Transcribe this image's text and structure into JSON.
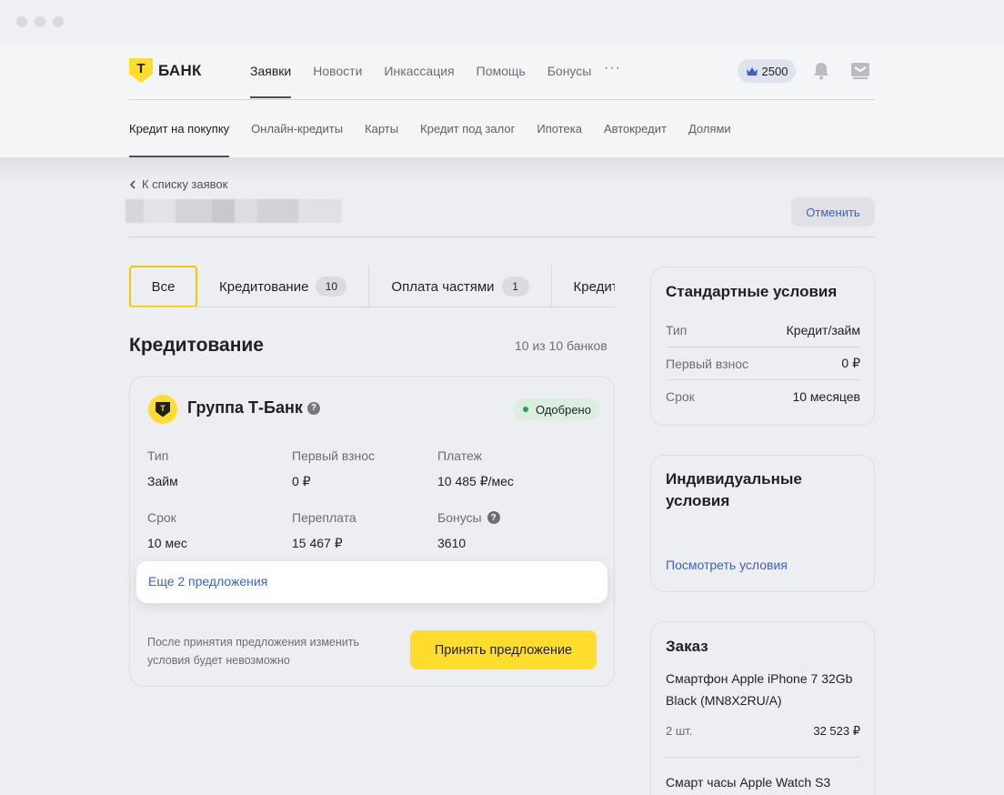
{
  "app": {
    "brand": "БАНК",
    "logo_letter": "Т"
  },
  "topnav": {
    "items": [
      "Заявки",
      "Новости",
      "Инкассация",
      "Помощь",
      "Бонусы"
    ],
    "more": "···",
    "bonus_points": "2500"
  },
  "subnav": {
    "items": [
      "Кредит на покупку",
      "Онлайн-кредиты",
      "Карты",
      "Кредит под залог",
      "Ипотека",
      "Автокредит",
      "Долями"
    ]
  },
  "page": {
    "back_link": "К списку заявок",
    "cancel_button": "Отменить"
  },
  "tabs": [
    {
      "label": "Все",
      "count": ""
    },
    {
      "label": "Кредитование",
      "count": "10"
    },
    {
      "label": "Оплата частями",
      "count": "1"
    },
    {
      "label": "Кредитные карты",
      "count": ""
    }
  ],
  "section": {
    "title": "Кредитование",
    "count": "10 из 10 банков"
  },
  "offer": {
    "bank_name": "Группа Т-Банк",
    "logo_letter": "Т",
    "status": "Одобрено",
    "fields": [
      {
        "label": "Тип",
        "value": "Займ"
      },
      {
        "label": "Первый взнос",
        "value": "0 ₽"
      },
      {
        "label": "Платеж",
        "value": "10 485 ₽/мес"
      },
      {
        "label": "Срок",
        "value": "10 мес"
      },
      {
        "label": "Переплата",
        "value": "15 467 ₽"
      },
      {
        "label": "Бонусы",
        "value": "3610"
      }
    ],
    "more_offers": "Еще 2 предложения",
    "disclaimer": "После принятия предложения изменить условия будет невозможно",
    "accept_button": "Принять предложение"
  },
  "standard_conditions": {
    "title": "Стандартные условия",
    "rows": [
      {
        "label": "Тип",
        "value": "Кредит/займ"
      },
      {
        "label": "Первый взнос",
        "value": "0 ₽"
      },
      {
        "label": "Срок",
        "value": "10 месяцев"
      }
    ]
  },
  "individual_conditions": {
    "title": "Индивидуальные условия",
    "link": "Посмотреть условия"
  },
  "order": {
    "title": "Заказ",
    "items": [
      {
        "name": "Смартфон Apple iPhone 7 32Gb Black (MN8X2RU/A)",
        "qty": "2 шт.",
        "price": "32 523 ₽"
      },
      {
        "name": "Смарт часы Apple Watch S3",
        "qty": "",
        "price": ""
      }
    ]
  },
  "colors": {
    "brand_yellow": "#ffdd2d",
    "link_blue": "#3b63c4",
    "status_green": "#24a44a"
  }
}
